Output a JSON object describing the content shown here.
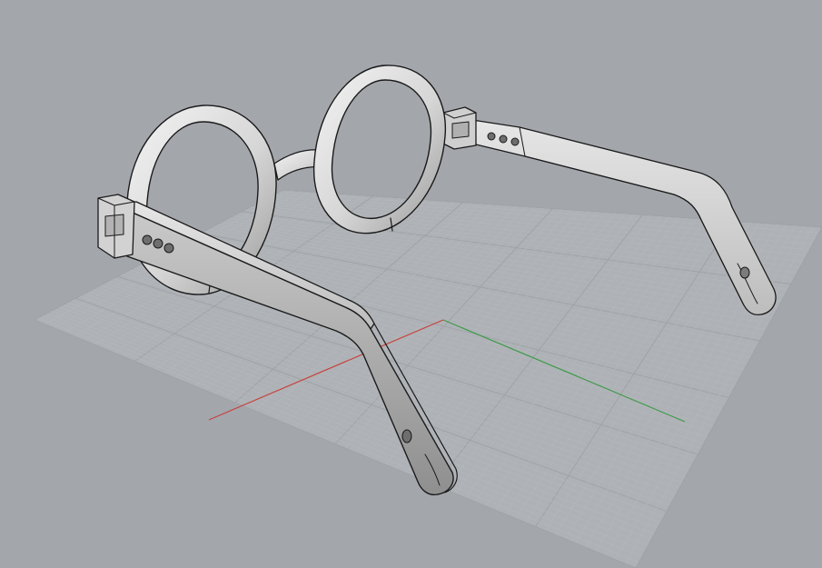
{
  "viewport": {
    "name": "Perspective",
    "background": "#a3a7ac",
    "grid": {
      "visible": true,
      "minor_color": "#b4b8bc",
      "major_color": "#9ea2a7",
      "plane_color": "#aeb2b6"
    },
    "axes": {
      "x_color": "#c8423f",
      "y_color": "#3f9a4a"
    }
  },
  "model": {
    "object": "round-eyeglasses",
    "surface_color": "#d9d9d9",
    "shadow_color": "#8c8c8c",
    "edge_color": "#1a1a1a",
    "parts": [
      "left-lens-rim",
      "right-lens-rim",
      "bridge",
      "left-temple-arm",
      "right-temple-arm",
      "left-hinge",
      "right-hinge"
    ]
  }
}
